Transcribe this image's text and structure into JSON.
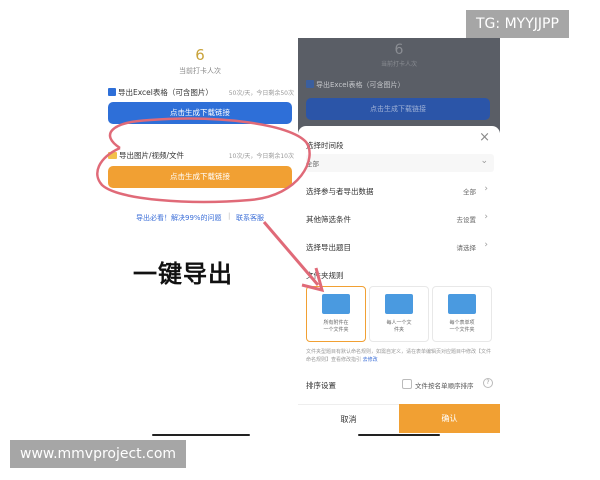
{
  "left": {
    "count": "6",
    "count_label": "当前打卡人次",
    "excel_title": "导出Excel表格（可含图片）",
    "excel_meta": "50次/天，今日剩余50次",
    "excel_button": "点击生成下载链接",
    "files_title": "导出图片/视频/文件",
    "files_meta": "10次/天，今日剩余10次",
    "files_button": "点击生成下载链接",
    "help_link": "导出必看！解决99%的问题",
    "separator": "|",
    "contact_link": "联系客服",
    "big_caption": "一键导出"
  },
  "right": {
    "bg_count": "6",
    "bg_count_label": "当前打卡人次",
    "bg_excel_title": "导出Excel表格（可含图片）",
    "bg_button": "点击生成下载链接",
    "close_glyph": "×",
    "time_label": "选择时间段",
    "time_value": "全部",
    "participants_label": "选择参与者导出数据",
    "participants_value": "全部",
    "filter_label": "其他筛选条件",
    "filter_value": "去设置",
    "questions_label": "选择导出题目",
    "questions_value": "请选择",
    "folder_rule_label": "文件夹规则",
    "cards": [
      {
        "line1": "所有附件在",
        "line2": "一个文件夹"
      },
      {
        "line1": "每人一个文",
        "line2": "件夹"
      },
      {
        "line1": "每个表单项",
        "line2": "一个文件夹"
      }
    ],
    "note": "文件夹型题目有默认命名规则，如需自定义，请在表单编辑页对应题目中修改【文件命名规则】查看修改指引",
    "note_link": "去修改",
    "sort_label": "排序设置",
    "sort_option": "文件按名单顺序排序",
    "cancel": "取消",
    "confirm": "确认"
  },
  "watermarks": {
    "top": "TG: MYYJJPP",
    "bottom": "www.mmvproject.com"
  },
  "colors": {
    "blue": "#2e6fd8",
    "orange": "#f1a033",
    "annotation_red": "#e06a78"
  }
}
